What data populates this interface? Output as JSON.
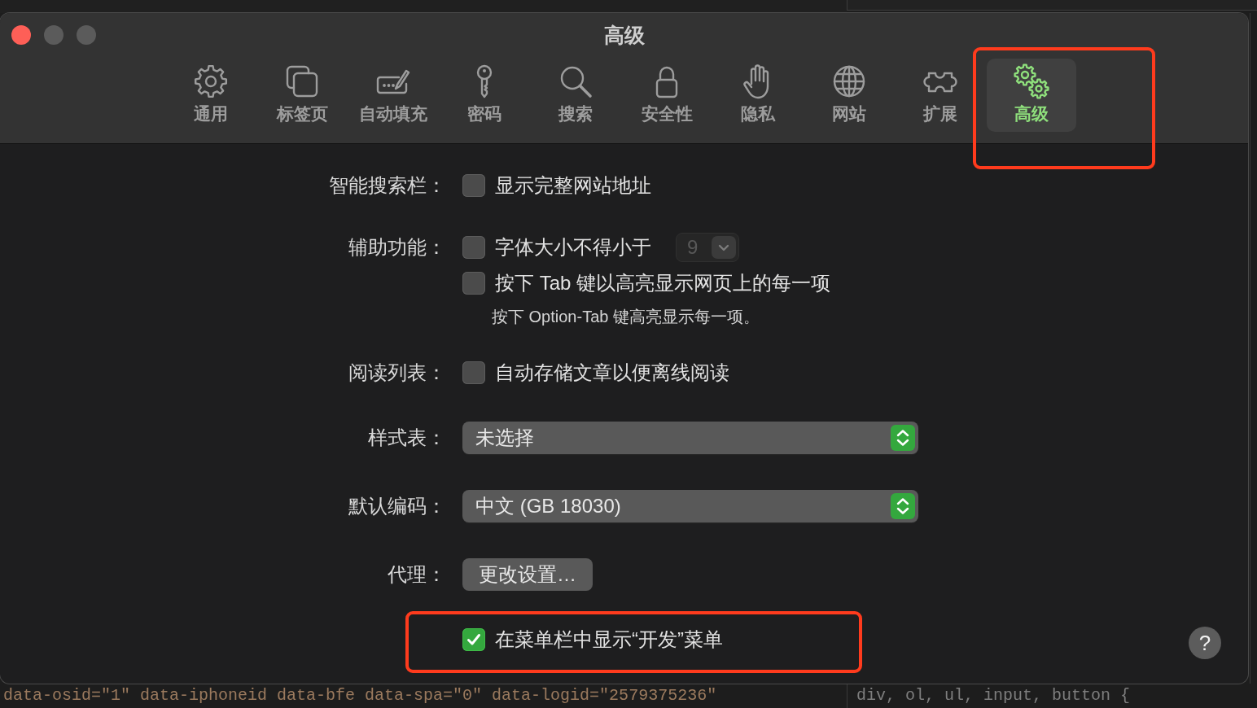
{
  "window": {
    "title": "高级",
    "controls": [
      {
        "kind": "close",
        "disabled": false
      },
      {
        "kind": "minimize",
        "disabled": true
      },
      {
        "kind": "zoom",
        "disabled": true
      }
    ]
  },
  "toolbar": {
    "items": [
      {
        "kind": "general",
        "label": "通用",
        "selected": false,
        "highlighted": false
      },
      {
        "kind": "tabs",
        "label": "标签页",
        "selected": false,
        "highlighted": false
      },
      {
        "kind": "autofill",
        "label": "自动填充",
        "selected": false,
        "highlighted": false
      },
      {
        "kind": "passwords",
        "label": "密码",
        "selected": false,
        "highlighted": false
      },
      {
        "kind": "search",
        "label": "搜索",
        "selected": false,
        "highlighted": false
      },
      {
        "kind": "security",
        "label": "安全性",
        "selected": false,
        "highlighted": false
      },
      {
        "kind": "privacy",
        "label": "隐私",
        "selected": false,
        "highlighted": false
      },
      {
        "kind": "websites",
        "label": "网站",
        "selected": false,
        "highlighted": false
      },
      {
        "kind": "extensions",
        "label": "扩展",
        "selected": false,
        "highlighted": false
      },
      {
        "kind": "advanced",
        "label": "高级",
        "selected": true,
        "highlighted": true
      }
    ]
  },
  "settings": [
    {
      "label": "智能搜索栏：",
      "controls": [
        {
          "kind": "checkbox",
          "text": "显示完整网站地址",
          "checked": false,
          "highlighted": false
        }
      ]
    },
    {
      "label": "辅助功能：",
      "controls": [
        {
          "kind": "checkbox",
          "text": "字体大小不得小于",
          "checked": false,
          "highlighted": false,
          "min_font_size": {
            "value": "9",
            "disabled": true
          }
        },
        {
          "kind": "checkbox",
          "text": "按下 Tab 键以高亮显示网页上的每一项",
          "checked": false,
          "highlighted": false
        },
        {
          "kind": "note",
          "text": "按下 Option-Tab 键高亮显示每一项。",
          "highlighted": false
        }
      ]
    },
    {
      "label": "阅读列表：",
      "controls": [
        {
          "kind": "checkbox",
          "text": "自动存储文章以便离线阅读",
          "checked": false,
          "highlighted": false
        }
      ]
    },
    {
      "label": "样式表：",
      "controls": [
        {
          "kind": "popup",
          "value": "未选择",
          "highlighted": false
        }
      ]
    },
    {
      "label": "默认编码：",
      "controls": [
        {
          "kind": "popup",
          "value": "中文 (GB 18030)",
          "highlighted": false
        }
      ]
    },
    {
      "label": "代理：",
      "controls": [
        {
          "kind": "button",
          "text": "更改设置…",
          "highlighted": false
        }
      ]
    },
    {
      "controls": [
        {
          "kind": "checkbox",
          "text": "在菜单栏中显示“开发”菜单",
          "checked": true,
          "highlighted": true
        }
      ]
    }
  ],
  "help_button": {
    "label": "?"
  },
  "background_editor": {
    "left_code": "data-osid=\"1\" data-iphoneid data-bfe data-spa=\"0\" data-logid=\"2579375236\"",
    "right_code": "div, ol, ul, input, button {"
  }
}
